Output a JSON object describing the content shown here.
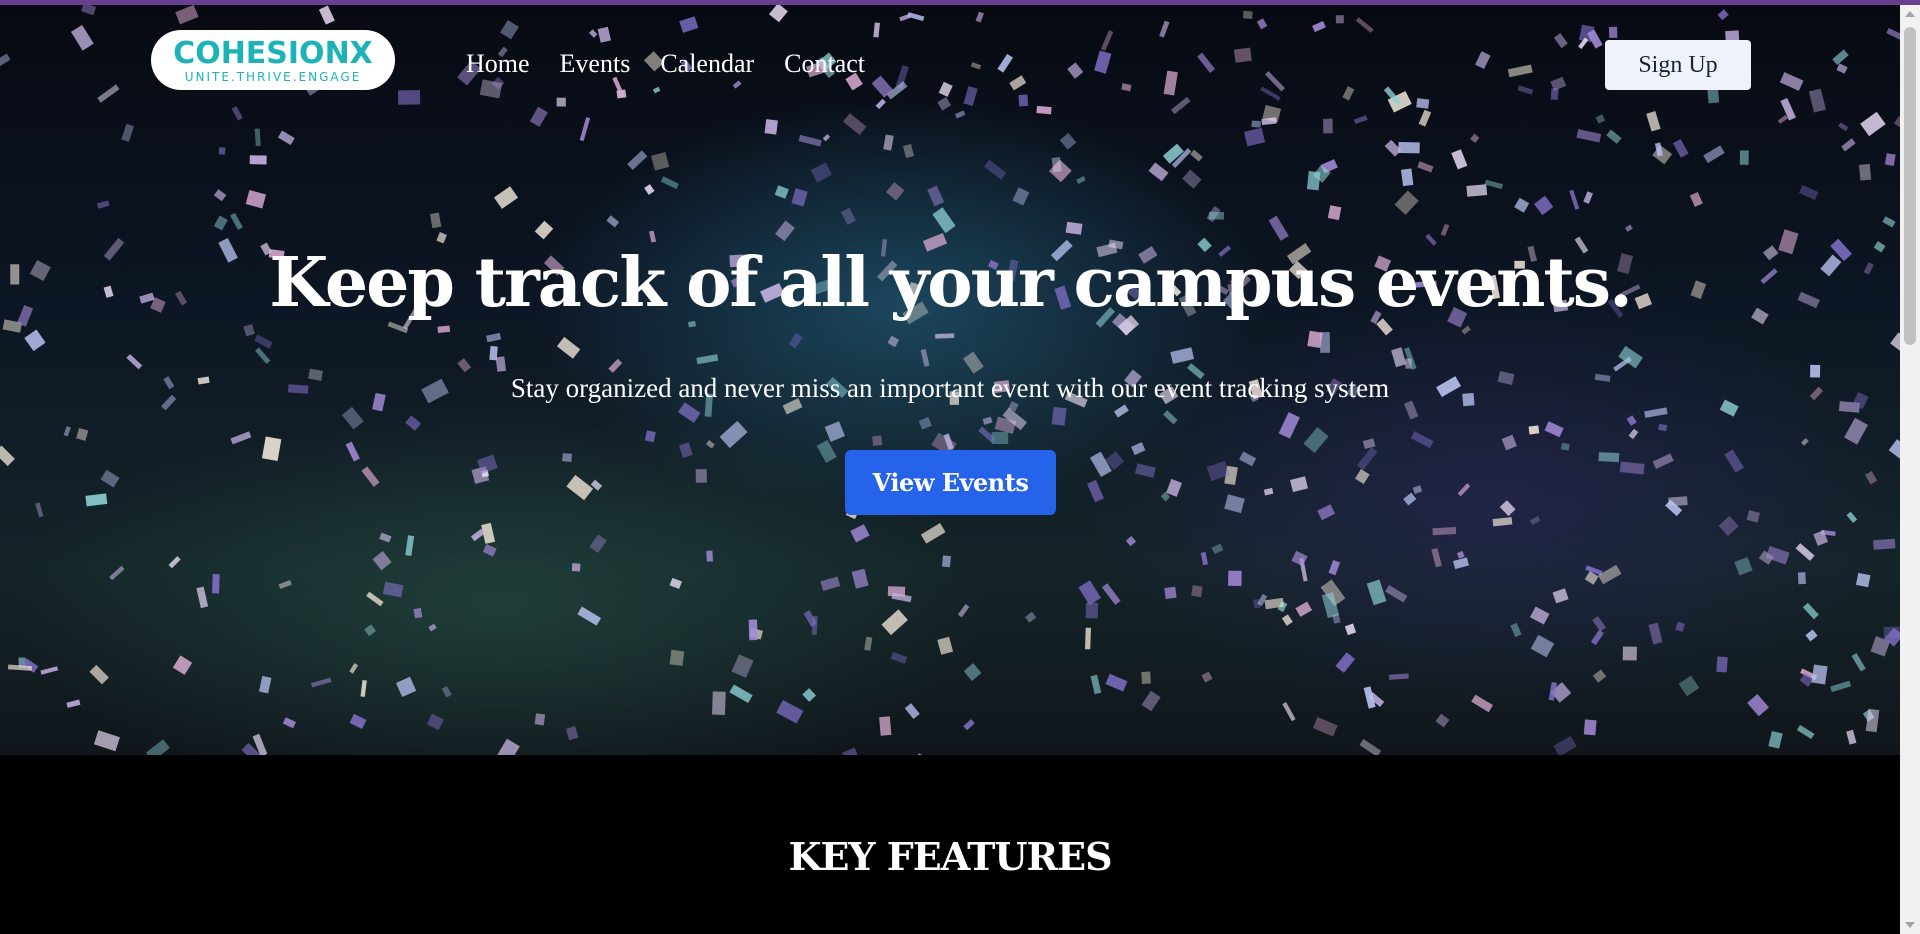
{
  "header": {
    "logo_main": "COHESIONX",
    "logo_tagline": "UNITE.THRIVE.ENGAGE",
    "nav": [
      "Home",
      "Events",
      "Calendar",
      "Contact"
    ],
    "signup_label": "Sign Up"
  },
  "hero": {
    "title": "Keep track of all your campus events.",
    "subtitle": "Stay organized and never miss an important event with our event tracking system",
    "cta_label": "View Events"
  },
  "features": {
    "title": "KEY FEATURES"
  },
  "colors": {
    "accent_button": "#2563eb",
    "logo_teal": "#1bb3b8",
    "top_strip": "#6b3f8f"
  },
  "icons": [
    "scroll-up-arrow-icon",
    "scroll-down-arrow-icon"
  ]
}
